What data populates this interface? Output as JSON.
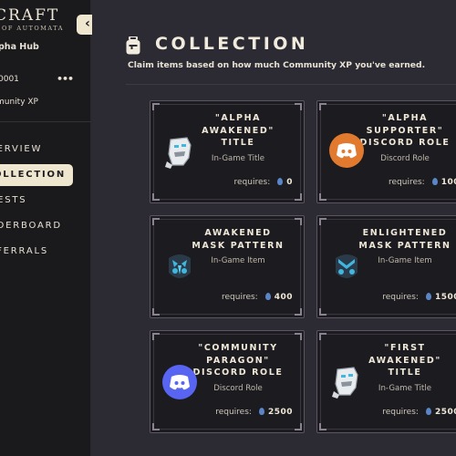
{
  "sidebar": {
    "logo_main": "CRAFT",
    "logo_sub": "OF AUTOMATA",
    "hub_name": "pha Hub",
    "user_id": "0001",
    "more": "•••",
    "xp_label": "munity XP",
    "collapse_icon": "chevron-left-icon",
    "nav": [
      {
        "label": "VERVIEW",
        "active": false
      },
      {
        "label": "OLLECTION",
        "active": true
      },
      {
        "label": "UESTS",
        "active": false
      },
      {
        "label": "ADERBOARD",
        "active": false
      },
      {
        "label": "EFERRALS",
        "active": false
      }
    ]
  },
  "main": {
    "title": "COLLECTION",
    "subtitle": "Claim items based on how much Community XP you've earned.",
    "requires_label": "requires:",
    "cards": [
      {
        "title_lines": [
          "\"ALPHA",
          "AWAKENED\"",
          "TITLE"
        ],
        "type": "In-Game Title",
        "xp": "0",
        "icon": "robot-icon"
      },
      {
        "title_lines": [
          "\"ALPHA",
          "SUPPORTER\"",
          "DISCORD ROLE"
        ],
        "type": "Discord Role",
        "xp": "100",
        "icon": "discord-orange-icon"
      },
      {
        "title_lines": [
          "AWAKENED",
          "MASK PATTERN"
        ],
        "type": "In-Game Item",
        "xp": "400",
        "icon": "mask-awakened-icon"
      },
      {
        "title_lines": [
          "ENLIGHTENED",
          "MASK PATTERN"
        ],
        "type": "In-Game Item",
        "xp": "1500",
        "icon": "mask-enlightened-icon"
      },
      {
        "title_lines": [
          "\"COMMUNITY",
          "PARAGON\"",
          "DISCORD ROLE"
        ],
        "type": "Discord Role",
        "xp": "2500",
        "icon": "discord-purple-icon"
      },
      {
        "title_lines": [
          "\"FIRST",
          "AWAKENED\"",
          "TITLE"
        ],
        "type": "In-Game Title",
        "xp": "2500",
        "icon": "robot-icon"
      }
    ]
  },
  "colors": {
    "accent": "#efe6cf",
    "xp_drop": "#5a86c8",
    "discord_orange": "#e17a2e",
    "discord_purple": "#5865f2"
  }
}
